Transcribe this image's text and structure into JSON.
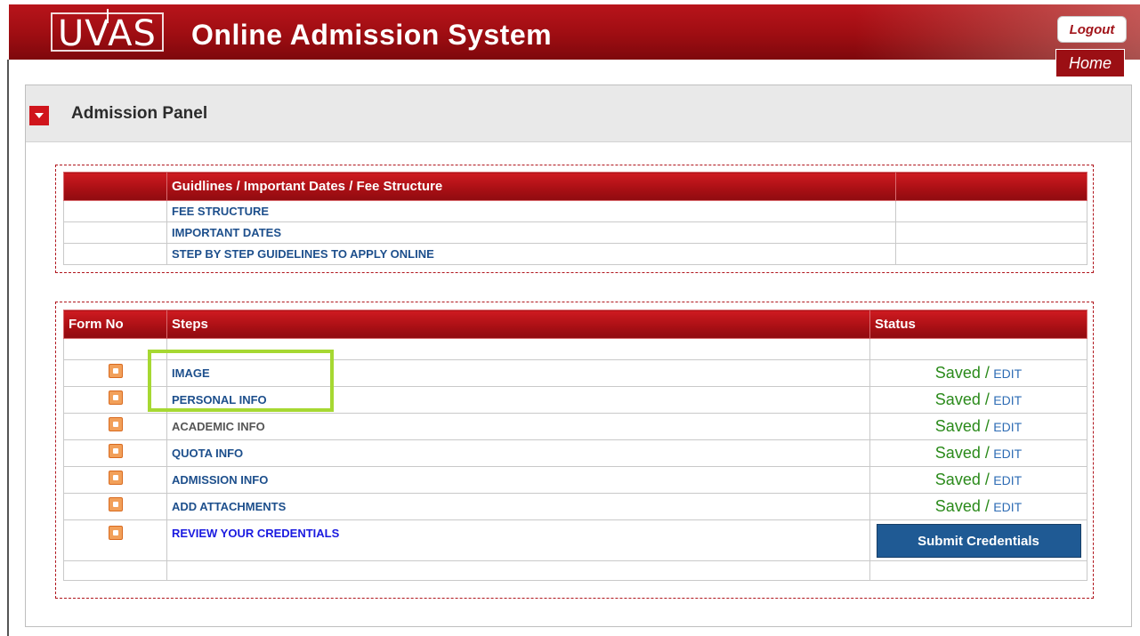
{
  "header": {
    "logo_text": "UVAS",
    "app_title": "Online Admission System",
    "logout_label": "Logout",
    "home_label": "Home"
  },
  "panel": {
    "title": "Admission Panel"
  },
  "guidelines_table": {
    "header": "Guidlines / Important Dates / Fee Structure",
    "rows": [
      "FEE STRUCTURE",
      "IMPORTANT DATES",
      "STEP BY STEP GUIDELINES TO APPLY ONLINE"
    ]
  },
  "steps_table": {
    "headers": {
      "form_no": "Form No",
      "steps": "Steps",
      "status": "Status"
    },
    "rows": [
      {
        "step": "IMAGE",
        "saved": "Saved /",
        "edit": "EDIT"
      },
      {
        "step": "PERSONAL INFO",
        "saved": "Saved /",
        "edit": "EDIT"
      },
      {
        "step": "ACADEMIC INFO",
        "saved": "Saved /",
        "edit": "EDIT"
      },
      {
        "step": "QUOTA INFO",
        "saved": "Saved /",
        "edit": "EDIT"
      },
      {
        "step": "ADMISSION INFO",
        "saved": "Saved /",
        "edit": "EDIT"
      },
      {
        "step": "ADD ATTACHMENTS",
        "saved": "Saved /",
        "edit": "EDIT"
      },
      {
        "step": "REVIEW YOUR CREDENTIALS"
      }
    ],
    "submit_label": "Submit Credentials"
  },
  "colors": {
    "header_red": "#9e0d12",
    "saved_green": "#2a8a1a",
    "link_blue": "#1d4f8c",
    "submit_blue": "#1f5a94",
    "highlight_green": "#a6d832"
  },
  "icons": {
    "toggle": "triangle-down-icon",
    "form": "form-icon"
  }
}
